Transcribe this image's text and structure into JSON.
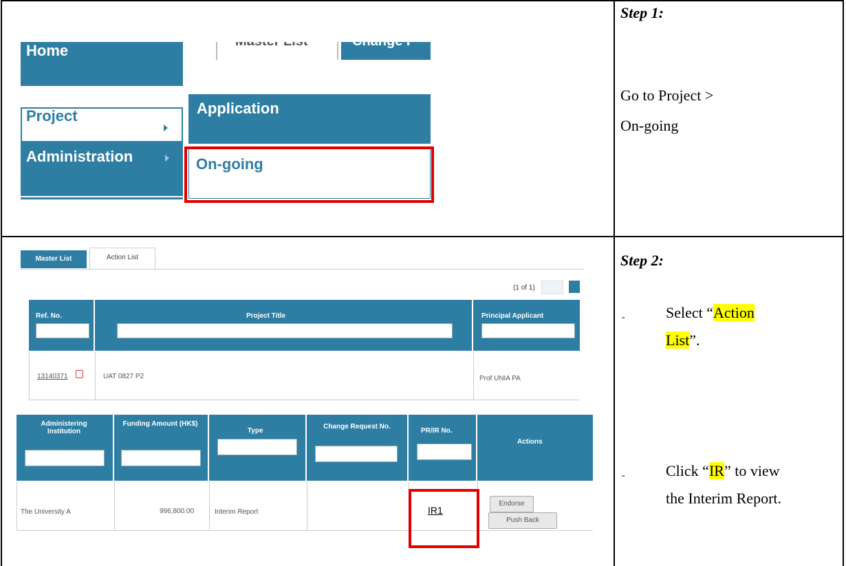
{
  "steps": [
    {
      "title": "Step 1:",
      "text_line1": "Go to Project >",
      "text_line2": "On-going"
    },
    {
      "title": "Step 2:",
      "bullet1": {
        "prefix": "Select “",
        "highlight_a": "Action",
        "highlight_b": "List",
        "suffix": "”."
      },
      "bullet2": {
        "prefix": "Click “",
        "highlight": "IR",
        "suffix": "” to view",
        "line2": "the Interim Report."
      },
      "bullet_mark": "-"
    }
  ],
  "shot1": {
    "nav": {
      "home": "Home",
      "project": "Project",
      "administration": "Administration"
    },
    "submenu": {
      "application": "Application",
      "ongoing": "On-going"
    },
    "tabs": {
      "master_list": "Master List",
      "change": "Change I"
    }
  },
  "shot2": {
    "tabs": {
      "master_list": "Master List",
      "action_list": "Action List"
    },
    "pager": "(1 of 1)",
    "table1": {
      "headers": [
        "Ref. No.",
        "Project Title",
        "Principal Applicant"
      ],
      "row": {
        "ref_no": "13140371",
        "project_title": "UAT 0827 P2",
        "principal_applicant": "Prof UNIA PA"
      }
    },
    "table2": {
      "headers": [
        "Administering Institution",
        "Funding Amount (HK$)",
        "Type",
        "Change Request No.",
        "PR/IR No.",
        "Actions"
      ],
      "row": {
        "institution": "The University A",
        "amount": "996,800.00",
        "type": "Interim Report",
        "change_request": "",
        "pr_ir_no": "IR1"
      },
      "buttons": {
        "endorse": "Endorse",
        "push_back": "Push Back"
      }
    }
  },
  "colors": {
    "nav_blue": "#2e7ea4",
    "highlight": "#ffff00",
    "red_box": "#e10000"
  }
}
